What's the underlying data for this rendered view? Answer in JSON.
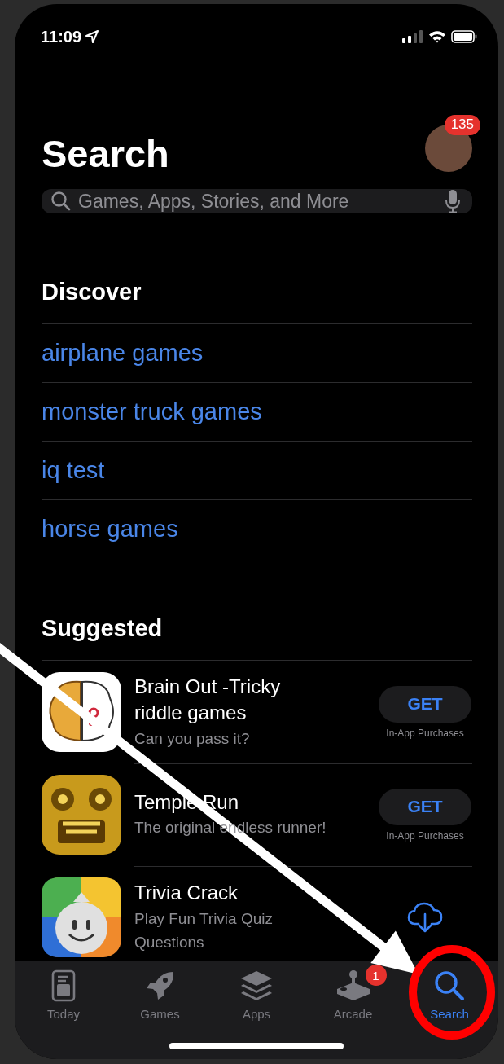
{
  "status_bar": {
    "time": "11:09"
  },
  "header": {
    "title": "Search",
    "avatar_badge": "135"
  },
  "search": {
    "placeholder": "Games, Apps, Stories, and More"
  },
  "discover": {
    "heading": "Discover",
    "items": [
      "airplane games",
      "monster truck games",
      "iq test",
      "horse games"
    ]
  },
  "suggested": {
    "heading": "Suggested",
    "apps": [
      {
        "kind": "get",
        "name": "Brain Out -Tricky riddle games",
        "subtitle": "Can you pass it?",
        "button": "GET",
        "note": "In-App Purchases"
      },
      {
        "kind": "get",
        "name": "Temple Run",
        "subtitle": "The original endless runner!",
        "button": "GET",
        "note": "In-App Purchases"
      },
      {
        "kind": "download",
        "name": "Trivia Crack",
        "subtitle": "Play Fun Trivia Quiz Questions"
      }
    ]
  },
  "tab_bar": [
    {
      "label": "Today",
      "selected": false
    },
    {
      "label": "Games",
      "selected": false
    },
    {
      "label": "Apps",
      "selected": false
    },
    {
      "label": "Arcade",
      "badge": "1",
      "selected": false
    },
    {
      "label": "Search",
      "selected": true
    }
  ]
}
